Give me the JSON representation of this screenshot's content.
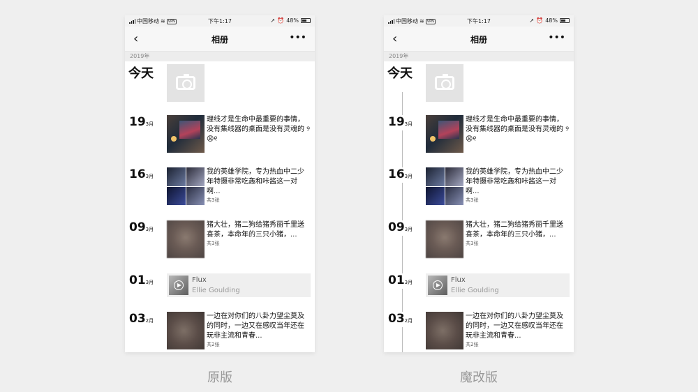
{
  "status": {
    "carrier": "中国移动",
    "vpn": "VPN",
    "time": "下午1:17",
    "battery": "48%"
  },
  "nav": {
    "back": "‹",
    "title": "相册",
    "more": "•••"
  },
  "year": "2019年",
  "today": "今天",
  "entries": [
    {
      "day": "19",
      "month": "3月",
      "text": "理线才是生命中最重要的事情，没有集线器的桌面是没有灵魂的 ୨😩୧",
      "count": ""
    },
    {
      "day": "16",
      "month": "3月",
      "text": "我的英雄学院，专为热血中二少年特摄非常吃轰和咔酱这一对啊...",
      "count": "共3张"
    },
    {
      "day": "09",
      "month": "3月",
      "text": "猪大壮，猪二狗给猪秀丽千里送喜茶，本命年的三只小猪，...",
      "count": "共3张"
    },
    {
      "day": "01",
      "month": "3月",
      "music_title": "Flux",
      "music_artist": "Ellie Goulding"
    },
    {
      "day": "03",
      "month": "2月",
      "text": "一边在对你们的八卦力望尘莫及的同时，一边又在感叹当年还在玩非主流和青春...",
      "count": "共2张"
    }
  ],
  "captions": {
    "left": "原版",
    "right": "魔改版"
  }
}
